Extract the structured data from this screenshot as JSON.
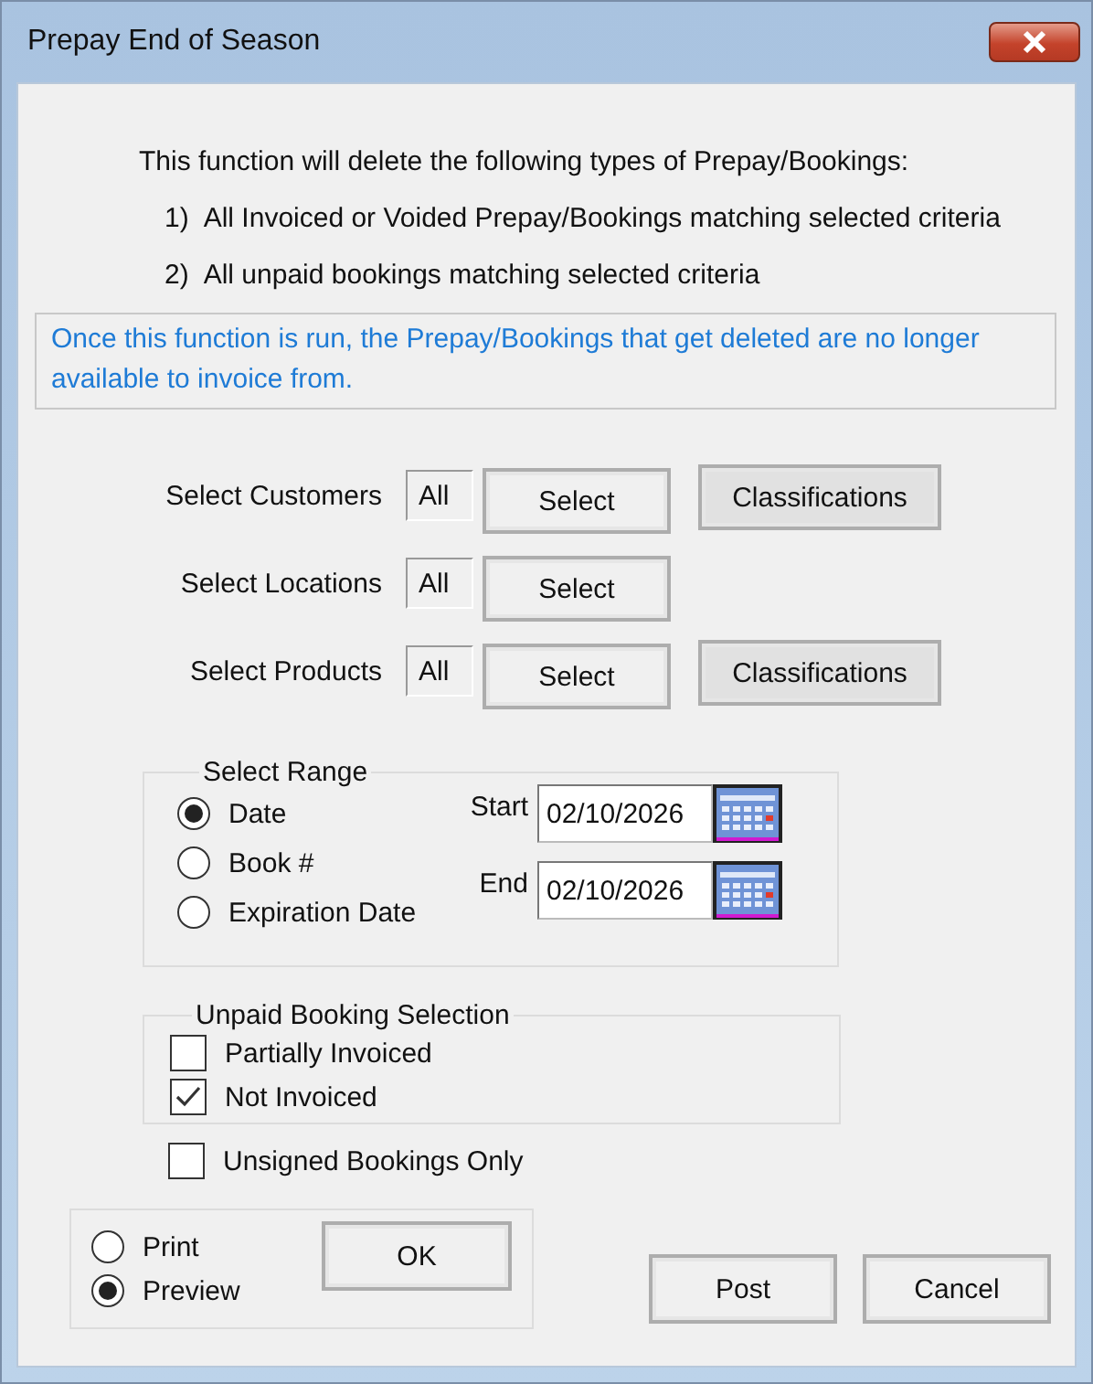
{
  "window": {
    "title": "Prepay End of Season"
  },
  "intro": "This function will delete the following types of Prepay/Bookings:",
  "items": [
    {
      "number": "1)",
      "text": "All Invoiced or Voided Prepay/Bookings matching selected criteria"
    },
    {
      "number": "2)",
      "text": "All unpaid bookings matching selected criteria"
    }
  ],
  "notice": "Once this function is run, the Prepay/Bookings that get deleted are no longer available to invoice from.",
  "selectors": [
    {
      "label": "Select Customers",
      "value": "All",
      "button": "Select",
      "classifications": "Classifications"
    },
    {
      "label": "Select Locations",
      "value": "All",
      "button": "Select"
    },
    {
      "label": "Select Products",
      "value": "All",
      "button": "Select",
      "classifications": "Classifications"
    }
  ],
  "range": {
    "title": "Select Range",
    "options": [
      {
        "label": "Date",
        "selected": true
      },
      {
        "label": "Book #",
        "selected": false
      },
      {
        "label": "Expiration Date",
        "selected": false
      }
    ],
    "start": {
      "label": "Start",
      "value": "02/10/2026"
    },
    "end": {
      "label": "End",
      "value": "02/10/2026"
    }
  },
  "unpaid": {
    "title": "Unpaid Booking Selection",
    "options": [
      {
        "label": "Partially Invoiced",
        "checked": false
      },
      {
        "label": "Not Invoiced",
        "checked": true
      }
    ]
  },
  "unsigned": {
    "label": "Unsigned Bookings Only",
    "checked": false
  },
  "output": {
    "options": [
      {
        "label": "Print",
        "selected": false
      },
      {
        "label": "Preview",
        "selected": true
      }
    ],
    "ok": "OK"
  },
  "buttons": [
    "Post",
    "Cancel"
  ]
}
